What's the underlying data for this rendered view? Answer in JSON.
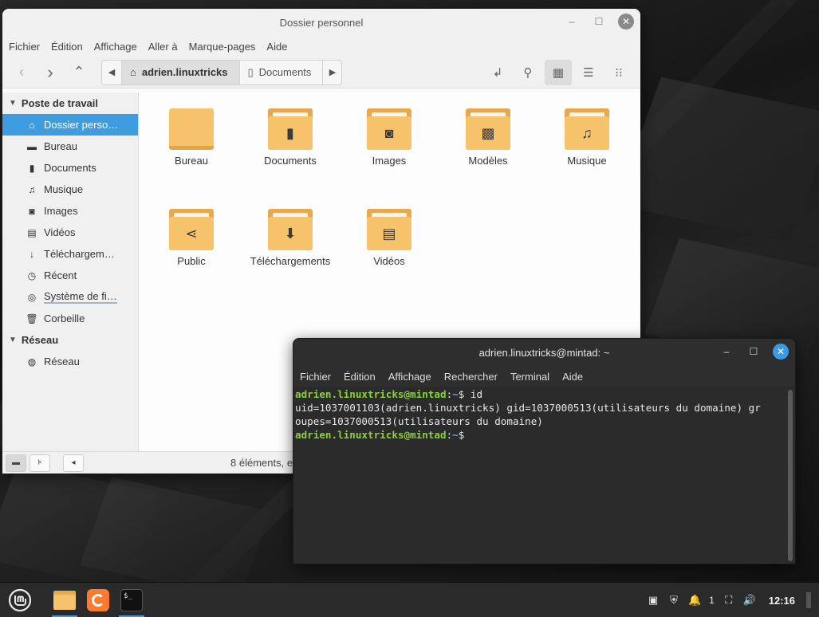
{
  "file_manager": {
    "title": "Dossier personnel",
    "menu": [
      "Fichier",
      "Édition",
      "Affichage",
      "Aller à",
      "Marque-pages",
      "Aide"
    ],
    "path": [
      "adrien.linuxtricks",
      "Documents"
    ],
    "sidebar": {
      "sections": [
        {
          "label": "Poste de travail",
          "items": [
            {
              "label": "Dossier perso…",
              "icon": "home-icon",
              "active": true
            },
            {
              "label": "Bureau",
              "icon": "desktop-icon"
            },
            {
              "label": "Documents",
              "icon": "document-icon"
            },
            {
              "label": "Musique",
              "icon": "music-icon"
            },
            {
              "label": "Images",
              "icon": "camera-icon"
            },
            {
              "label": "Vidéos",
              "icon": "film-icon"
            },
            {
              "label": "Téléchargem…",
              "icon": "download-icon"
            },
            {
              "label": "Récent",
              "icon": "clock-icon"
            },
            {
              "label": "Système de fi…",
              "icon": "drive-icon"
            },
            {
              "label": "Corbeille",
              "icon": "trash-icon"
            }
          ]
        },
        {
          "label": "Réseau",
          "items": [
            {
              "label": "Réseau",
              "icon": "network-icon"
            }
          ]
        }
      ]
    },
    "files": [
      {
        "label": "Bureau",
        "emblem": ""
      },
      {
        "label": "Documents",
        "emblem": "document"
      },
      {
        "label": "Images",
        "emblem": "camera"
      },
      {
        "label": "Modèles",
        "emblem": "template"
      },
      {
        "label": "Musique",
        "emblem": "music"
      },
      {
        "label": "Public",
        "emblem": "share"
      },
      {
        "label": "Téléchargements",
        "emblem": "download"
      },
      {
        "label": "Vidéos",
        "emblem": "film"
      }
    ],
    "status": "8 éléments, e"
  },
  "terminal": {
    "title": "adrien.linuxtricks@mintad: ~",
    "menu": [
      "Fichier",
      "Édition",
      "Affichage",
      "Rechercher",
      "Terminal",
      "Aide"
    ],
    "prompt_user": "adrien.linuxtricks@mintad",
    "prompt_path": "~",
    "command": "id",
    "output_line1": "uid=1037001103(adrien.linuxtricks) gid=1037000513(utilisateurs du domaine) gr",
    "output_line2": "oupes=1037000513(utilisateurs du domaine)"
  },
  "taskbar": {
    "notification_count": "1",
    "clock": "12:16"
  }
}
